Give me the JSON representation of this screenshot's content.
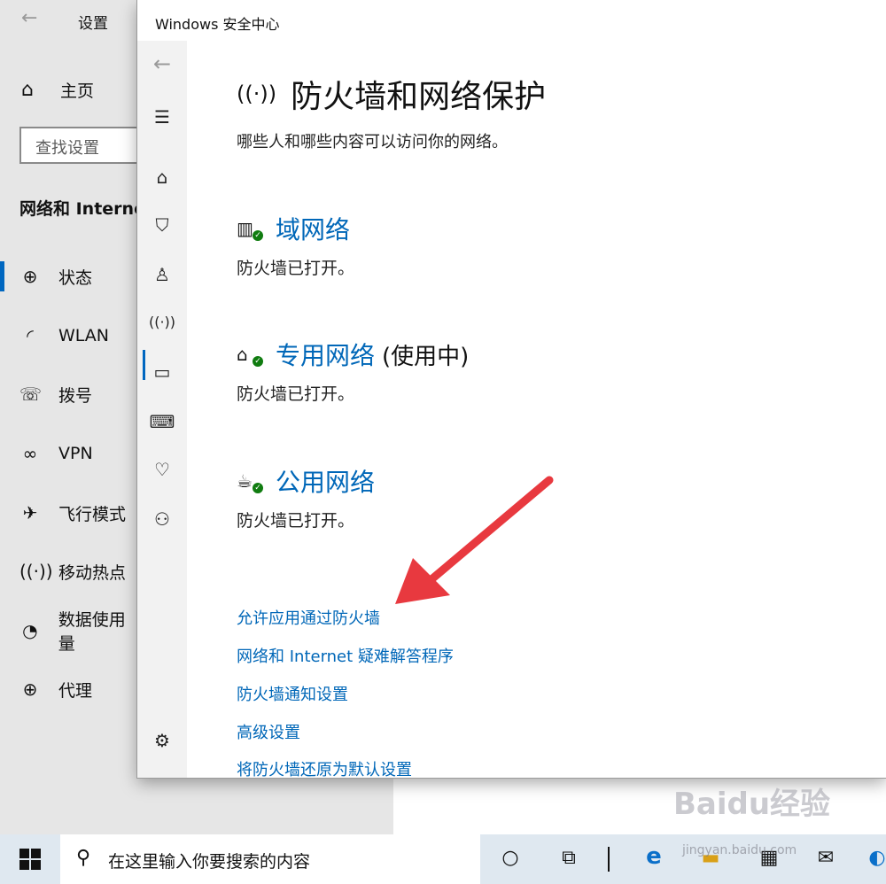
{
  "settings": {
    "title": "设置",
    "home_label": "主页",
    "search_placeholder": "查找设置",
    "category": "网络和 Internet",
    "nav": [
      {
        "label": "状态",
        "icon": "globe-monitor-icon"
      },
      {
        "label": "WLAN",
        "icon": "wifi-icon"
      },
      {
        "label": "拨号",
        "icon": "dialup-icon"
      },
      {
        "label": "VPN",
        "icon": "vpn-icon"
      },
      {
        "label": "飞行模式",
        "icon": "airplane-icon"
      },
      {
        "label": "移动热点",
        "icon": "hotspot-icon"
      },
      {
        "label": "数据使用量",
        "icon": "pie-chart-icon"
      },
      {
        "label": "代理",
        "icon": "globe-icon"
      }
    ]
  },
  "security_center": {
    "window_title": "Windows 安全中心",
    "heading": "防火墙和网络保护",
    "subtitle": "哪些人和哪些内容可以访问你的网络。",
    "networks": [
      {
        "name": "域网络",
        "status": "防火墙已打开。",
        "in_use": "",
        "icon": "domain-network-icon"
      },
      {
        "name": "专用网络",
        "status": "防火墙已打开。",
        "in_use": "(使用中)",
        "icon": "private-network-icon"
      },
      {
        "name": "公用网络",
        "status": "防火墙已打开。",
        "in_use": "",
        "icon": "public-network-icon"
      }
    ],
    "links": {
      "allow_app": "允许应用通过防火墙",
      "troubleshooter": "网络和 Internet 疑难解答程序",
      "notifications": "防火墙通知设置",
      "advanced": "高级设置",
      "restore": "将防火墙还原为默认设置"
    }
  },
  "taskbar": {
    "search_placeholder": "在这里输入你要搜索的内容"
  },
  "watermark": {
    "brand": "Baidu经验",
    "site": "jingyan.baidu.com"
  },
  "colors": {
    "link": "#0067b8",
    "accent": "#0067c0",
    "check_green": "#107c10",
    "arrow_red": "#e8393f"
  }
}
